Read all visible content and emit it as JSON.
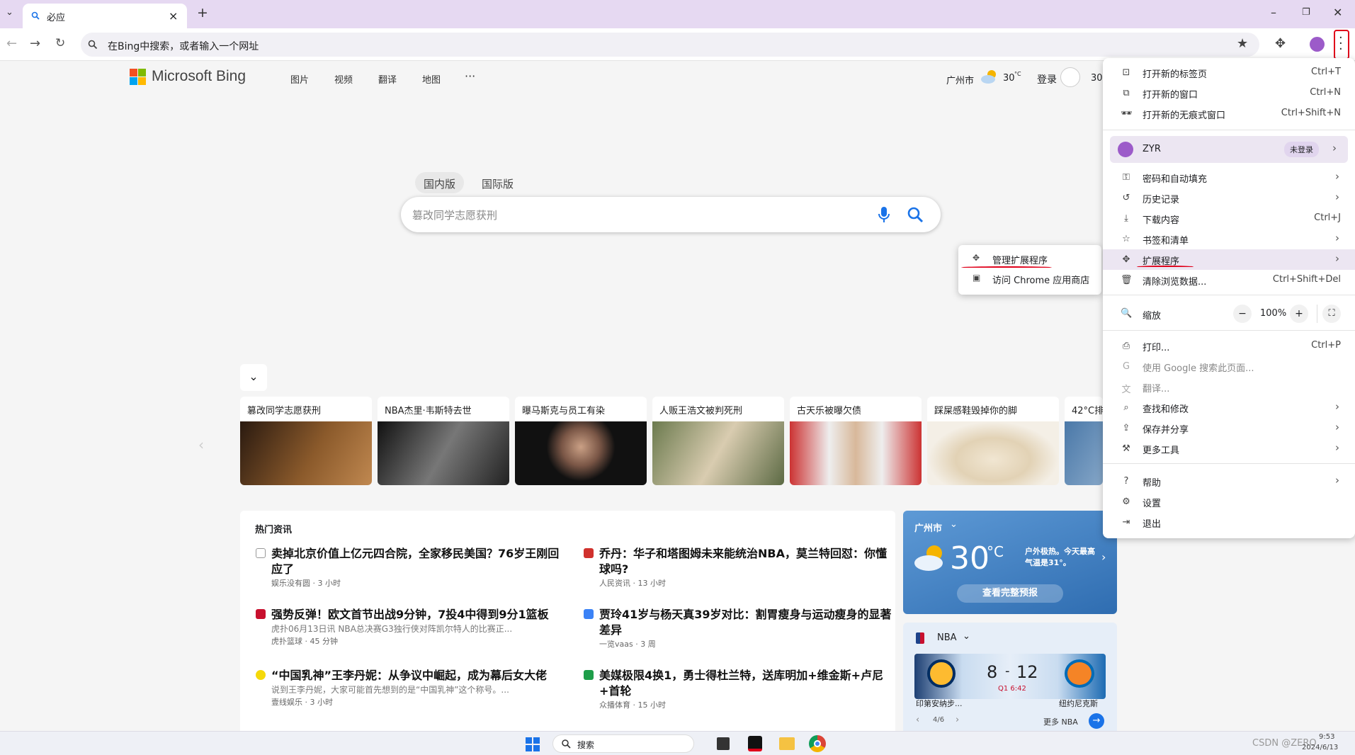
{
  "browser": {
    "tab_title": "必应",
    "new_tab": "+",
    "address_placeholder": "在Bing中搜索，或者输入一个网址"
  },
  "bing": {
    "logo_text": "Microsoft Bing",
    "nav": [
      "图片",
      "视频",
      "翻译",
      "地图",
      "···"
    ],
    "city": "广州市",
    "temp": "30",
    "temp_unit": "°C",
    "login": "登录",
    "points": "30",
    "scope_tabs": [
      "国内版",
      "国际版"
    ],
    "search_placeholder": "篡改同学志愿获刑"
  },
  "trending": [
    {
      "caption": "篡改同学志愿获刑",
      "color": "#5a3a22"
    },
    {
      "caption": "NBA杰里·韦斯特去世",
      "color": "#2a2a2a"
    },
    {
      "caption": "曝马斯克与员工有染",
      "color": "#1a1a1a"
    },
    {
      "caption": "人贩王浩文被判死刑",
      "color": "#7c8a5e"
    },
    {
      "caption": "古天乐被曝欠债",
      "color": "#b33a3a"
    },
    {
      "caption": "踩屎感鞋毁掉你的脚",
      "color": "#d9cbb4"
    },
    {
      "caption": "42°C排",
      "color": "#4a78a8"
    }
  ],
  "news": {
    "heading": "热门资讯",
    "items": [
      {
        "headline": "卖掉北京价值上亿元四合院，全家移民美国？76岁王刚回应了",
        "snippet": "",
        "source": "娱乐没有圆 · 3 小时",
        "icon_color": "#ffffff"
      },
      {
        "headline": "乔丹：华子和塔图姆未来能统治NBA，莫兰特回怼：你懂球吗?",
        "snippet": "",
        "source": "人民资讯 · 13 小时",
        "icon_color": "#d0312d"
      },
      {
        "headline": "强势反弹！欧文首节出战9分钟，7投4中得到9分1篮板",
        "snippet": "虎扑06月13日讯 NBA总决赛G3独行侠对阵凯尔特人的比赛正...",
        "source": "虎扑篮球 · 45 分钟",
        "icon_color": "#c8102e"
      },
      {
        "headline": "贾玲41岁与杨天真39岁对比：割胃瘦身与运动瘦身的显著差异",
        "snippet": "",
        "source": "一览vaas · 3 周",
        "icon_color": "#3b82f6"
      },
      {
        "headline": "“中国乳神”王李丹妮：从争议中崛起，成为幕后女大佬",
        "snippet": "说到王李丹妮，大家可能首先想到的是“中国乳神”这个称号。...",
        "source": "壹线娱乐 · 3 小时",
        "icon_color": "#f5d90a"
      },
      {
        "headline": "美媒极限4换1，勇士得杜兰特，送库明加+维金斯+卢尼+首轮",
        "snippet": "",
        "source": "众播体育 · 15 小时",
        "icon_color": "#1e9e4a"
      }
    ]
  },
  "weather": {
    "city": "广州市",
    "temp": "30",
    "unit": "°C",
    "note": "户外极热。今天最高气温是31°。",
    "link": "查看完整预报"
  },
  "nba": {
    "title": "NBA",
    "score_home": "8",
    "score_sep": "-",
    "score_away": "12",
    "period": "Q1 6:42",
    "team_home": "印第安纳步...",
    "team_away": "纽约尼克斯",
    "pager": "4/6",
    "more": "更多 NBA"
  },
  "menu": {
    "items": [
      {
        "label": "打开新的标签页",
        "shortcut": "Ctrl+T",
        "icon": "new-tab-icon",
        "glyph": "⊡"
      },
      {
        "label": "打开新的窗口",
        "shortcut": "Ctrl+N",
        "icon": "new-window-icon",
        "glyph": "⧉"
      },
      {
        "label": "打开新的无痕式窗口",
        "shortcut": "Ctrl+Shift+N",
        "icon": "incognito-icon",
        "glyph": "🕶"
      },
      {
        "label": "ZYR",
        "badge": "未登录",
        "icon": "profile-icon",
        "glyph": "●"
      },
      {
        "label": "密码和自动填充",
        "icon": "key-icon",
        "glyph": "⚿"
      },
      {
        "label": "历史记录",
        "icon": "history-icon",
        "glyph": "↺"
      },
      {
        "label": "下载内容",
        "shortcut": "Ctrl+J",
        "icon": "download-icon",
        "glyph": "⤓"
      },
      {
        "label": "书签和清单",
        "icon": "star-icon",
        "glyph": "☆"
      },
      {
        "label": "扩展程序",
        "icon": "extension-icon",
        "glyph": "✥"
      },
      {
        "label": "清除浏览数据...",
        "shortcut": "Ctrl+Shift+Del",
        "icon": "trash-icon",
        "glyph": "🗑"
      },
      {
        "label": "缩放",
        "icon": "zoom-icon",
        "glyph": "🔍"
      },
      {
        "label": "打印...",
        "shortcut": "Ctrl+P",
        "icon": "print-icon",
        "glyph": "⎙"
      },
      {
        "label": "使用 Google 搜索此页面...",
        "icon": "google-icon",
        "glyph": "G"
      },
      {
        "label": "翻译...",
        "icon": "translate-icon",
        "glyph": "文"
      },
      {
        "label": "查找和修改",
        "icon": "find-icon",
        "glyph": "⌕"
      },
      {
        "label": "保存并分享",
        "icon": "save-share-icon",
        "glyph": "⇪"
      },
      {
        "label": "更多工具",
        "icon": "tools-icon",
        "glyph": "⚒"
      },
      {
        "label": "帮助",
        "icon": "help-icon",
        "glyph": "?"
      },
      {
        "label": "设置",
        "icon": "settings-icon",
        "glyph": "⚙"
      },
      {
        "label": "退出",
        "icon": "exit-icon",
        "glyph": "⇥"
      }
    ],
    "zoom_minus": "−",
    "zoom_value": "100%",
    "zoom_plus": "+",
    "fullscreen": "⛶"
  },
  "submenu": {
    "items": [
      "管理扩展程序",
      "访问 Chrome 应用商店"
    ]
  },
  "taskbar": {
    "search_label": "搜索",
    "clock_time": "9:53",
    "clock_date": "2024/6/13",
    "watermark": "CSDN @ZERO"
  },
  "colors": {
    "annotation_red": "#e0001a",
    "bing_blue": "#1a73e8",
    "menu_hover": "#ece6f2"
  }
}
